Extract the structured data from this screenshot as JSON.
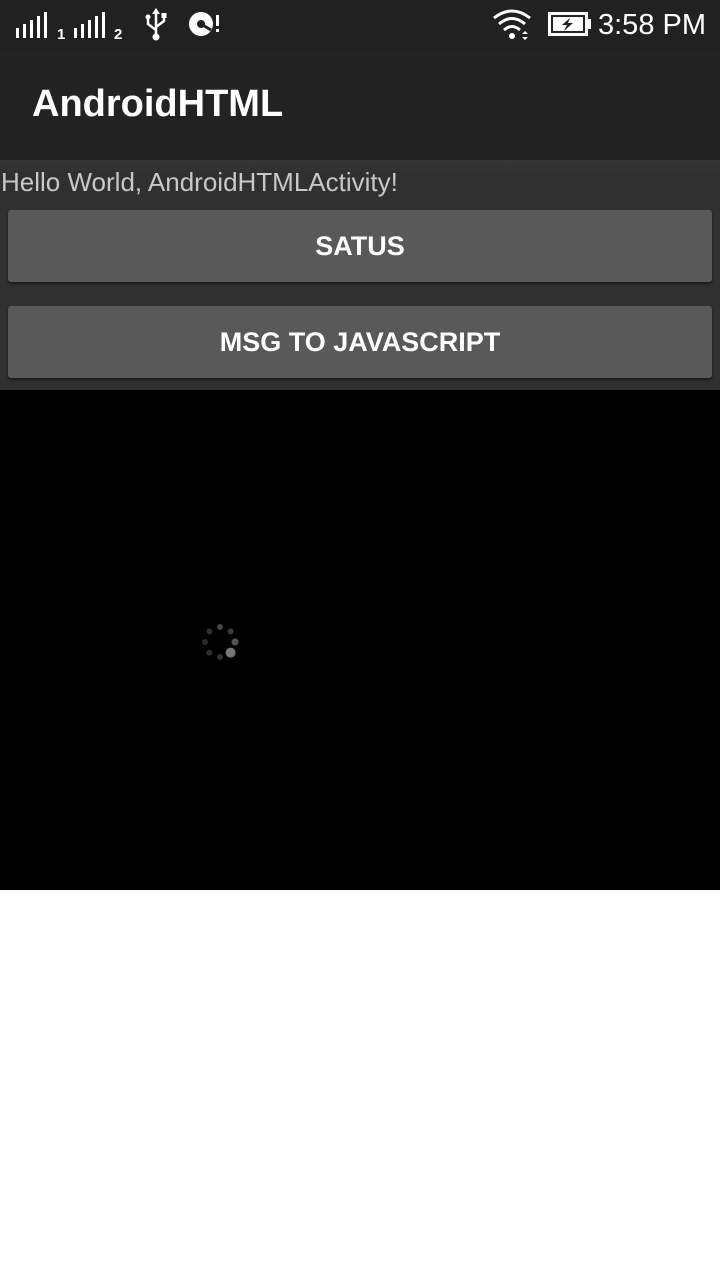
{
  "status_bar": {
    "sim1_label": "1",
    "sim2_label": "2",
    "time": "3:58 PM",
    "icons": [
      "signal-sim1-icon",
      "signal-sim2-icon",
      "usb-icon",
      "sync-alert-icon",
      "wifi-icon",
      "battery-charging-icon"
    ]
  },
  "action_bar": {
    "title": "AndroidHTML"
  },
  "content": {
    "hello_text": "Hello World, AndroidHTMLActivity!",
    "status_button_label": "SATUS",
    "msg_button_label": "MSG TO JAVASCRIPT"
  },
  "webview": {
    "loading_icon": "loading-spinner-icon"
  },
  "colors": {
    "status_bar_bg": "#212121",
    "action_bar_bg": "#232323",
    "content_bg": "#303030",
    "button_bg": "#595959",
    "webview_bg": "#000000",
    "text_light": "#c8c8c8"
  }
}
